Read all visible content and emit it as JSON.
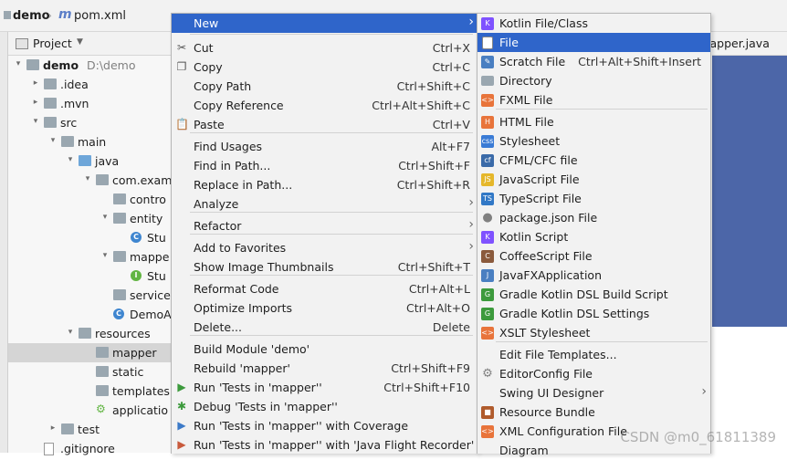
{
  "breadcrumb": {
    "project": "demo",
    "file": "pom.xml"
  },
  "project_panel": {
    "title": "Project",
    "dropdown_icon": "triangle-down"
  },
  "tree": [
    {
      "label": "demo",
      "path": "D:\\demo"
    },
    {
      "label": ".idea"
    },
    {
      "label": ".mvn"
    },
    {
      "label": "src"
    },
    {
      "label": "main"
    },
    {
      "label": "java"
    },
    {
      "label": "com.exam"
    },
    {
      "label": "contro"
    },
    {
      "label": "entity"
    },
    {
      "label": "Stu"
    },
    {
      "label": "mappe"
    },
    {
      "label": "Stu"
    },
    {
      "label": "service"
    },
    {
      "label": "DemoA"
    },
    {
      "label": "resources"
    },
    {
      "label": "mapper"
    },
    {
      "label": "static"
    },
    {
      "label": "templates"
    },
    {
      "label": "applicatio"
    },
    {
      "label": "test"
    },
    {
      "label": ".gitignore"
    }
  ],
  "editor_tab": {
    "label": "lapper.java"
  },
  "context_menu": {
    "items": [
      {
        "label": "New",
        "shortcut": "",
        "submenu": true
      },
      {
        "label": "Cut",
        "shortcut": "Ctrl+X",
        "icon": "scissors-icon"
      },
      {
        "label": "Copy",
        "shortcut": "Ctrl+C",
        "icon": "copy-icon"
      },
      {
        "label": "Copy Path",
        "shortcut": "Ctrl+Shift+C"
      },
      {
        "label": "Copy Reference",
        "shortcut": "Ctrl+Alt+Shift+C"
      },
      {
        "label": "Paste",
        "shortcut": "Ctrl+V",
        "icon": "paste-icon"
      },
      {
        "label": "Find Usages",
        "shortcut": "Alt+F7"
      },
      {
        "label": "Find in Path...",
        "shortcut": "Ctrl+Shift+F"
      },
      {
        "label": "Replace in Path...",
        "shortcut": "Ctrl+Shift+R"
      },
      {
        "label": "Analyze",
        "shortcut": "",
        "submenu": true
      },
      {
        "label": "Refactor",
        "shortcut": "",
        "submenu": true
      },
      {
        "label": "Add to Favorites",
        "shortcut": "",
        "submenu": true
      },
      {
        "label": "Show Image Thumbnails",
        "shortcut": "Ctrl+Shift+T"
      },
      {
        "label": "Reformat Code",
        "shortcut": "Ctrl+Alt+L"
      },
      {
        "label": "Optimize Imports",
        "shortcut": "Ctrl+Alt+O"
      },
      {
        "label": "Delete...",
        "shortcut": "Delete"
      },
      {
        "label": "Build Module 'demo'",
        "shortcut": ""
      },
      {
        "label": "Rebuild 'mapper'",
        "shortcut": "Ctrl+Shift+F9"
      },
      {
        "label": "Run 'Tests in 'mapper''",
        "shortcut": "Ctrl+Shift+F10",
        "icon": "run-icon"
      },
      {
        "label": "Debug 'Tests in 'mapper''",
        "shortcut": "",
        "icon": "debug-icon"
      },
      {
        "label": "Run 'Tests in 'mapper'' with Coverage",
        "shortcut": "",
        "icon": "coverage-icon"
      },
      {
        "label": "Run 'Tests in 'mapper'' with 'Java Flight Recorder'",
        "shortcut": "",
        "icon": "recorder-icon"
      }
    ]
  },
  "new_submenu": {
    "items": [
      {
        "label": "Kotlin File/Class",
        "shortcut": "",
        "icon": "kotlin-icon"
      },
      {
        "label": "File",
        "shortcut": "",
        "icon": "file-icon"
      },
      {
        "label": "Scratch File",
        "shortcut": "Ctrl+Alt+Shift+Insert",
        "icon": "scratch-icon"
      },
      {
        "label": "Directory",
        "shortcut": "",
        "icon": "folder-icon"
      },
      {
        "label": "FXML File",
        "shortcut": "",
        "icon": "fxml-icon"
      },
      {
        "label": "HTML File",
        "shortcut": "",
        "icon": "html-icon"
      },
      {
        "label": "Stylesheet",
        "shortcut": "",
        "icon": "css-icon"
      },
      {
        "label": "CFML/CFC file",
        "shortcut": "",
        "icon": "cf-icon"
      },
      {
        "label": "JavaScript File",
        "shortcut": "",
        "icon": "js-icon"
      },
      {
        "label": "TypeScript File",
        "shortcut": "",
        "icon": "ts-icon"
      },
      {
        "label": "package.json File",
        "shortcut": "",
        "icon": "npm-icon"
      },
      {
        "label": "Kotlin Script",
        "shortcut": "",
        "icon": "kotlin-icon"
      },
      {
        "label": "CoffeeScript File",
        "shortcut": "",
        "icon": "coffee-icon"
      },
      {
        "label": "JavaFXApplication",
        "shortcut": "",
        "icon": "java-icon"
      },
      {
        "label": "Gradle Kotlin DSL Build Script",
        "shortcut": "",
        "icon": "gradle-icon"
      },
      {
        "label": "Gradle Kotlin DSL Settings",
        "shortcut": "",
        "icon": "gradle-icon"
      },
      {
        "label": "XSLT Stylesheet",
        "shortcut": "",
        "icon": "xslt-icon"
      },
      {
        "label": "Edit File Templates...",
        "shortcut": ""
      },
      {
        "label": "EditorConfig File",
        "shortcut": "",
        "icon": "gear-icon"
      },
      {
        "label": "Swing UI Designer",
        "shortcut": "",
        "submenu": true
      },
      {
        "label": "Resource Bundle",
        "shortcut": "",
        "icon": "bundle-icon"
      },
      {
        "label": "XML Configuration File",
        "shortcut": "",
        "icon": "xml-icon"
      },
      {
        "label": "Diagram",
        "shortcut": ""
      }
    ]
  },
  "watermark": "CSDN @m0_61811389",
  "colors": {
    "highlight": "#2f65ca",
    "editor_bg": "#4c66a8"
  }
}
